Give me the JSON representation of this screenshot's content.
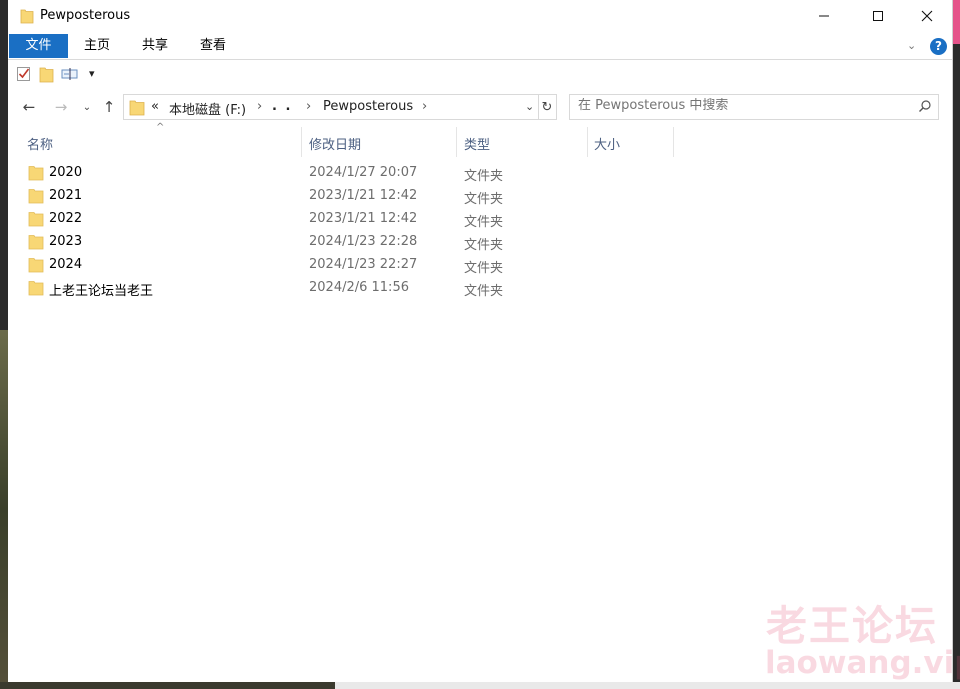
{
  "window": {
    "title": "Pewposterous",
    "controls": {
      "minimize": "—",
      "maximize": "☐",
      "close": "✕"
    }
  },
  "ribbon": {
    "tabs": [
      {
        "label": "文件",
        "active": true
      },
      {
        "label": "主页"
      },
      {
        "label": "共享"
      },
      {
        "label": "查看"
      }
    ],
    "help": "?"
  },
  "address": {
    "overflow": "«",
    "crumbs": [
      "本地磁盘 (F:)",
      ". .",
      "Pewposterous"
    ],
    "separator": "›"
  },
  "search": {
    "placeholder": "在 Pewposterous 中搜索"
  },
  "columns": {
    "name": "名称",
    "date": "修改日期",
    "type": "类型",
    "size": "大小"
  },
  "files": [
    {
      "name": "2020",
      "date": "2024/1/27 20:07",
      "type": "文件夹"
    },
    {
      "name": "2021",
      "date": "2023/1/21 12:42",
      "type": "文件夹"
    },
    {
      "name": "2022",
      "date": "2023/1/21 12:42",
      "type": "文件夹"
    },
    {
      "name": "2023",
      "date": "2024/1/23 22:28",
      "type": "文件夹"
    },
    {
      "name": "2024",
      "date": "2024/1/23 22:27",
      "type": "文件夹"
    },
    {
      "name": "上老王论坛当老王",
      "date": "2024/2/6 11:56",
      "type": "文件夹"
    }
  ],
  "watermark": {
    "cn": "老王论坛",
    "en": "laowang.vip"
  },
  "colors": {
    "accent": "#1a6fc4",
    "folder": "#f8d775",
    "header_text": "#4d6082"
  }
}
